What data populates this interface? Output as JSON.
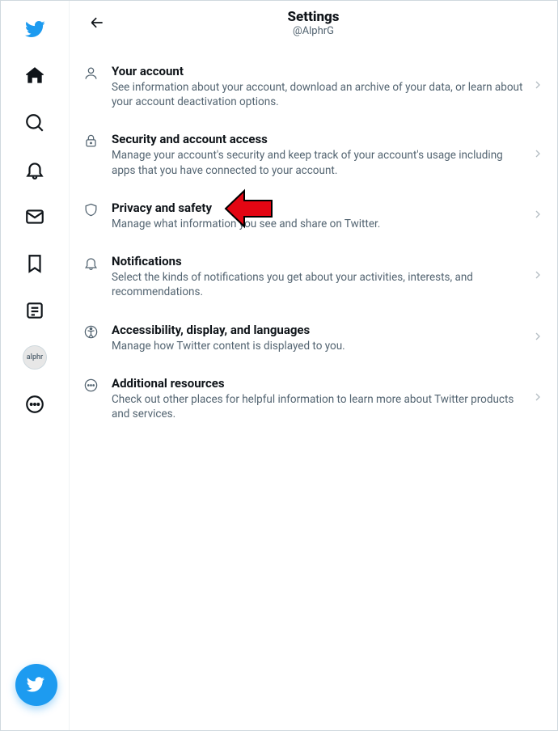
{
  "header": {
    "title": "Settings",
    "handle": "@AlphrG"
  },
  "sidebar": {
    "avatar_label": "alphr"
  },
  "settings": [
    {
      "icon": "person",
      "title": "Your account",
      "desc": "See information about your account, download an archive of your data, or learn about your account deactivation options."
    },
    {
      "icon": "lock",
      "title": "Security and account access",
      "desc": "Manage your account's security and keep track of your account's usage including apps that you have connected to your account."
    },
    {
      "icon": "shield",
      "title": "Privacy and safety",
      "desc": "Manage what information you see and share on Twitter."
    },
    {
      "icon": "bell",
      "title": "Notifications",
      "desc": "Select the kinds of notifications you get about your activities, interests, and recommendations."
    },
    {
      "icon": "accessibility",
      "title": "Accessibility, display, and languages",
      "desc": "Manage how Twitter content is displayed to you."
    },
    {
      "icon": "ellipsis",
      "title": "Additional resources",
      "desc": "Check out other places for helpful information to learn more about Twitter products and services."
    }
  ]
}
